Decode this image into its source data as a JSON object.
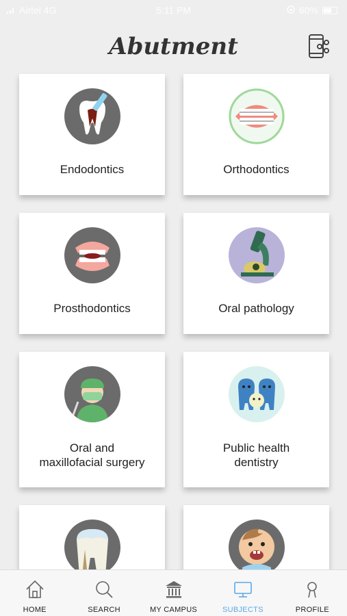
{
  "status_bar": {
    "carrier": "Airtel 4G",
    "time": "5:11 PM",
    "battery": "60%"
  },
  "header": {
    "title": "Abutment",
    "share_icon": "phone-share-icon"
  },
  "subjects": [
    {
      "label_1": "Endodontics",
      "label_2": "",
      "icon": "tooth-root-canal-icon"
    },
    {
      "label_1": "Orthodontics",
      "label_2": "",
      "icon": "braces-icon"
    },
    {
      "label_1": "Prosthodontics",
      "label_2": "",
      "icon": "denture-icon"
    },
    {
      "label_1": "Oral pathology",
      "label_2": "",
      "icon": "microscope-icon"
    },
    {
      "label_1": "Oral and",
      "label_2": "maxillofacial surgery",
      "icon": "surgeon-icon"
    },
    {
      "label_1": "Public health",
      "label_2": "dentistry",
      "icon": "tooth-family-icon"
    },
    {
      "label_1": "",
      "label_2": "",
      "icon": "decayed-tooth-icon"
    },
    {
      "label_1": "",
      "label_2": "",
      "icon": "baby-teeth-icon"
    }
  ],
  "nav": [
    {
      "label": "HOME",
      "icon": "home-icon"
    },
    {
      "label": "SEARCH",
      "icon": "search-icon"
    },
    {
      "label": "MY CAMPUS",
      "icon": "campus-building-icon"
    },
    {
      "label": "SUBJECTS",
      "icon": "monitor-icon",
      "active": true
    },
    {
      "label": "PROFILE",
      "icon": "profile-icon"
    }
  ],
  "colors": {
    "accent": "#5aa8e6",
    "background": "#efeeef"
  }
}
